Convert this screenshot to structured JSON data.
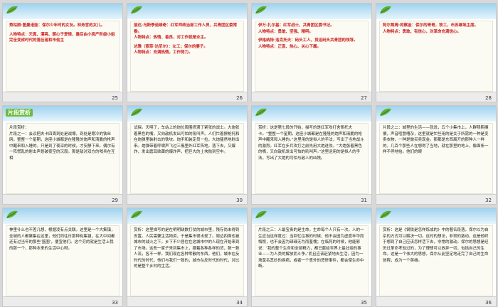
{
  "slides": [
    {
      "num": "25",
      "badge": "",
      "lines": [
        {
          "t": "秀姑娘·图曼诺娃：保尔少年时的女友。林务官的女儿。",
          "c": "red"
        },
        {
          "t": "",
          "c": "gap"
        },
        {
          "t": "人物特点：天真、漂亮、朝心于爱情，最后由小资产阶级小姐完全变成时代的落伍者和市侩主",
          "c": "red"
        }
      ]
    },
    {
      "num": "26",
      "badge": "",
      "lines": [
        {
          "t": "丽达·乌斯季诺维奇：红军师政治部工作人员，共青团区委常委。",
          "c": "red"
        },
        {
          "t": "人物特点：热情、善良，对工作就是业主。",
          "c": "red"
        },
        {
          "t": "",
          "c": "gap"
        },
        {
          "t": "达雅（索菲·达尼尔）：女工；保尔的妻子。",
          "c": "red"
        },
        {
          "t": "人物特点：充满热情，工作努力。",
          "c": "red"
        }
      ]
    },
    {
      "num": "27",
      "badge": "",
      "lines": [
        {
          "t": "伊万·扎尔基：红军战士，共青团区委书记。",
          "c": "red"
        },
        {
          "t": "人物特点：勇敢、坚强、精明。",
          "c": "red"
        },
        {
          "t": "",
          "c": "gap"
        },
        {
          "t": "伊格纳特·洛克托夫：码头工人，货运码头共青团的领导。",
          "c": "red"
        },
        {
          "t": "人物特点：正直、热心、关心下属。",
          "c": "red"
        }
      ]
    },
    {
      "num": "28",
      "badge": "",
      "lines": [
        {
          "t": "阿尔焦姆·柯察金：保尔的哥哥，铁工，市苏维埃主席。",
          "c": "red"
        },
        {
          "t": "人物特点：勇敢、有信心，对革命充满信心。",
          "c": "red"
        }
      ]
    },
    {
      "num": "29",
      "badge": "片段赏析",
      "lines": [
        {
          "t": "片段赏析：",
          "c": ""
        },
        {
          "t": "片段之一：会议把夫卡四周到处是战壕，到处是寒冷的铁丝网。整整一个星期，这座小城都是在隆隆的炮声和清脆的枪声中醒来和入睡的。只是到了夜深的时候，才安静下来。偶尔有一阵慌乱的射击声划破夜空的沉寂。那是敌对双方的哨兵在互相",
          "c": ""
        }
      ]
    },
    {
      "num": "30",
      "badge": "",
      "lines": [
        {
          "t": "试探。天明了，车站上的炮位周围挤满了紧张的战士。大炮张着黑色的嘴，又向敌机发出可怕的吼叫声。人们忙着擦枪托和在炮弹里装射击的铁块。炮手和装定员一拉，大炮猛然地射出来。炮弹带着呼啸声飞过三俄里外红军阵地，落下去，又爆炸，发出震耳欲聋的爆炸声，把巨大的土块抛到空中。",
          "c": ""
        }
      ]
    },
    {
      "num": "31",
      "badge": "",
      "lines": [
        {
          "t": "赏析：这是第七段的开始，描写的是红军攻打舍佩托夫卡。“整整一个星期，这座小城都是在隆隆的炮声和清脆的枪声中醒来和入睡的。”这里用的是拟人的手法，写出了当地战斗的激烈。红军在步兵攻打之前先用大炮进攻。“大炮张着黑色的嘴，又向敌机发出可怕的吼叫声。”这里运用的是拟人的手法，写出了大炮的可怕与敌人的凶残。",
          "c": ""
        }
      ]
    },
    {
      "num": "32",
      "badge": "",
      "lines": [
        {
          "t": "片段之二：城里的生活——就说，五个小集市上，人群熙熙攘攘，声音喧嚣嘈杂，这里就是忙些用的是关于所需的一种是变卖衣物，一种是做买卖现金。那都是东西离开的那种人一样的。几百个那些人在想得了当地，就在那里的地上，像面条一样不停地抬。他们的眼",
          "c": ""
        }
      ]
    },
    {
      "num": "33",
      "badge": "",
      "lines": [
        {
          "t": "神里什么也不差几想，根据凌有点关联。这里是一个大集镇，全城的人都聚集在这里，他们同往日那种有集镇，在大中间都还有过当年的那些‘篮圈’，便宜他们。这个穷的就是生活上我的那一个，那种本来的生活中心呀。",
          "c": ""
        }
      ]
    },
    {
      "num": "34",
      "badge": "",
      "lines": [
        {
          "t": "赏析：这里描写的是在明明缺数打仗的城市里，残存尚未得到安置。人民需要生活物资，于是集市很出现了。周边四面也被城市的战火之下，乡下不少居住在这城市中的人现在开始来到了市场。这些一家子来到集市上，摆着各种各样的货，数一数人流，各不一样。我们现在各种零散的东西，他们，城市在反时代的时代，他们与我们一致的，城市在反时代的时代，对比的是整个乡村的生活。",
          "c": ""
        }
      ]
    },
    {
      "num": "35",
      "badge": "",
      "lines": [
        {
          "t": "片段之三：人最宝贵的是生命。生命每个人只有一次。人的一生应当这样度过：当回忆往事的时候，他不会因为虚度年华而悔恨，也不会因为碌碌无为而羞愧；在临死的时候，他能够说：‘我的整个生命和全部精力，都已献给世界上最壮丽的事业——为人类的解放而斗争。’而且应该赶紧地去生活，因为一场莫名其妙的疾病，或者一个意外的悲惨事件，都会使生命中断。",
          "c": ""
        }
      ]
    },
    {
      "num": "36",
      "badge": "",
      "lines": [
        {
          "t": "赏析：这是《钢铁是怎样炼成的》中的著名段落，保尔以为自杀的方式可以解决一切。这时的想法，非常的激动，这是他终于想到了自己应该怎样活下去，非常的激动。保尔的思想是经历过革命考验过的，为了理想可以放弃一切，包括自己的生命。这是一个伟大的思想，保尔从此坚定地走完了自己的生命旅程，成为一个英雄。",
          "c": ""
        }
      ]
    }
  ]
}
